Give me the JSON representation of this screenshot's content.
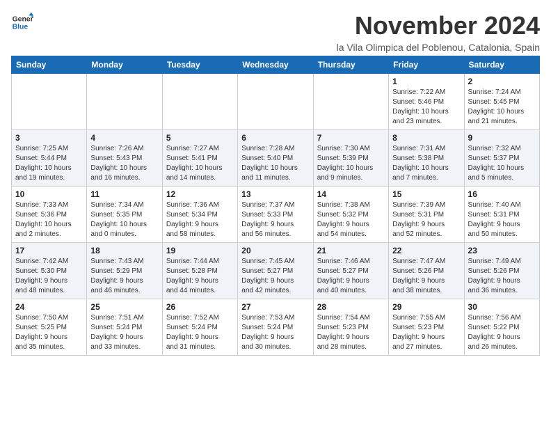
{
  "logo": {
    "line1": "General",
    "line2": "Blue"
  },
  "title": "November 2024",
  "subtitle": "la Vila Olimpica del Poblenou, Catalonia, Spain",
  "weekdays": [
    "Sunday",
    "Monday",
    "Tuesday",
    "Wednesday",
    "Thursday",
    "Friday",
    "Saturday"
  ],
  "weeks": [
    [
      {
        "day": "",
        "info": ""
      },
      {
        "day": "",
        "info": ""
      },
      {
        "day": "",
        "info": ""
      },
      {
        "day": "",
        "info": ""
      },
      {
        "day": "",
        "info": ""
      },
      {
        "day": "1",
        "info": "Sunrise: 7:22 AM\nSunset: 5:46 PM\nDaylight: 10 hours\nand 23 minutes."
      },
      {
        "day": "2",
        "info": "Sunrise: 7:24 AM\nSunset: 5:45 PM\nDaylight: 10 hours\nand 21 minutes."
      }
    ],
    [
      {
        "day": "3",
        "info": "Sunrise: 7:25 AM\nSunset: 5:44 PM\nDaylight: 10 hours\nand 19 minutes."
      },
      {
        "day": "4",
        "info": "Sunrise: 7:26 AM\nSunset: 5:43 PM\nDaylight: 10 hours\nand 16 minutes."
      },
      {
        "day": "5",
        "info": "Sunrise: 7:27 AM\nSunset: 5:41 PM\nDaylight: 10 hours\nand 14 minutes."
      },
      {
        "day": "6",
        "info": "Sunrise: 7:28 AM\nSunset: 5:40 PM\nDaylight: 10 hours\nand 11 minutes."
      },
      {
        "day": "7",
        "info": "Sunrise: 7:30 AM\nSunset: 5:39 PM\nDaylight: 10 hours\nand 9 minutes."
      },
      {
        "day": "8",
        "info": "Sunrise: 7:31 AM\nSunset: 5:38 PM\nDaylight: 10 hours\nand 7 minutes."
      },
      {
        "day": "9",
        "info": "Sunrise: 7:32 AM\nSunset: 5:37 PM\nDaylight: 10 hours\nand 5 minutes."
      }
    ],
    [
      {
        "day": "10",
        "info": "Sunrise: 7:33 AM\nSunset: 5:36 PM\nDaylight: 10 hours\nand 2 minutes."
      },
      {
        "day": "11",
        "info": "Sunrise: 7:34 AM\nSunset: 5:35 PM\nDaylight: 10 hours\nand 0 minutes."
      },
      {
        "day": "12",
        "info": "Sunrise: 7:36 AM\nSunset: 5:34 PM\nDaylight: 9 hours\nand 58 minutes."
      },
      {
        "day": "13",
        "info": "Sunrise: 7:37 AM\nSunset: 5:33 PM\nDaylight: 9 hours\nand 56 minutes."
      },
      {
        "day": "14",
        "info": "Sunrise: 7:38 AM\nSunset: 5:32 PM\nDaylight: 9 hours\nand 54 minutes."
      },
      {
        "day": "15",
        "info": "Sunrise: 7:39 AM\nSunset: 5:31 PM\nDaylight: 9 hours\nand 52 minutes."
      },
      {
        "day": "16",
        "info": "Sunrise: 7:40 AM\nSunset: 5:31 PM\nDaylight: 9 hours\nand 50 minutes."
      }
    ],
    [
      {
        "day": "17",
        "info": "Sunrise: 7:42 AM\nSunset: 5:30 PM\nDaylight: 9 hours\nand 48 minutes."
      },
      {
        "day": "18",
        "info": "Sunrise: 7:43 AM\nSunset: 5:29 PM\nDaylight: 9 hours\nand 46 minutes."
      },
      {
        "day": "19",
        "info": "Sunrise: 7:44 AM\nSunset: 5:28 PM\nDaylight: 9 hours\nand 44 minutes."
      },
      {
        "day": "20",
        "info": "Sunrise: 7:45 AM\nSunset: 5:27 PM\nDaylight: 9 hours\nand 42 minutes."
      },
      {
        "day": "21",
        "info": "Sunrise: 7:46 AM\nSunset: 5:27 PM\nDaylight: 9 hours\nand 40 minutes."
      },
      {
        "day": "22",
        "info": "Sunrise: 7:47 AM\nSunset: 5:26 PM\nDaylight: 9 hours\nand 38 minutes."
      },
      {
        "day": "23",
        "info": "Sunrise: 7:49 AM\nSunset: 5:26 PM\nDaylight: 9 hours\nand 36 minutes."
      }
    ],
    [
      {
        "day": "24",
        "info": "Sunrise: 7:50 AM\nSunset: 5:25 PM\nDaylight: 9 hours\nand 35 minutes."
      },
      {
        "day": "25",
        "info": "Sunrise: 7:51 AM\nSunset: 5:24 PM\nDaylight: 9 hours\nand 33 minutes."
      },
      {
        "day": "26",
        "info": "Sunrise: 7:52 AM\nSunset: 5:24 PM\nDaylight: 9 hours\nand 31 minutes."
      },
      {
        "day": "27",
        "info": "Sunrise: 7:53 AM\nSunset: 5:24 PM\nDaylight: 9 hours\nand 30 minutes."
      },
      {
        "day": "28",
        "info": "Sunrise: 7:54 AM\nSunset: 5:23 PM\nDaylight: 9 hours\nand 28 minutes."
      },
      {
        "day": "29",
        "info": "Sunrise: 7:55 AM\nSunset: 5:23 PM\nDaylight: 9 hours\nand 27 minutes."
      },
      {
        "day": "30",
        "info": "Sunrise: 7:56 AM\nSunset: 5:22 PM\nDaylight: 9 hours\nand 26 minutes."
      }
    ]
  ]
}
